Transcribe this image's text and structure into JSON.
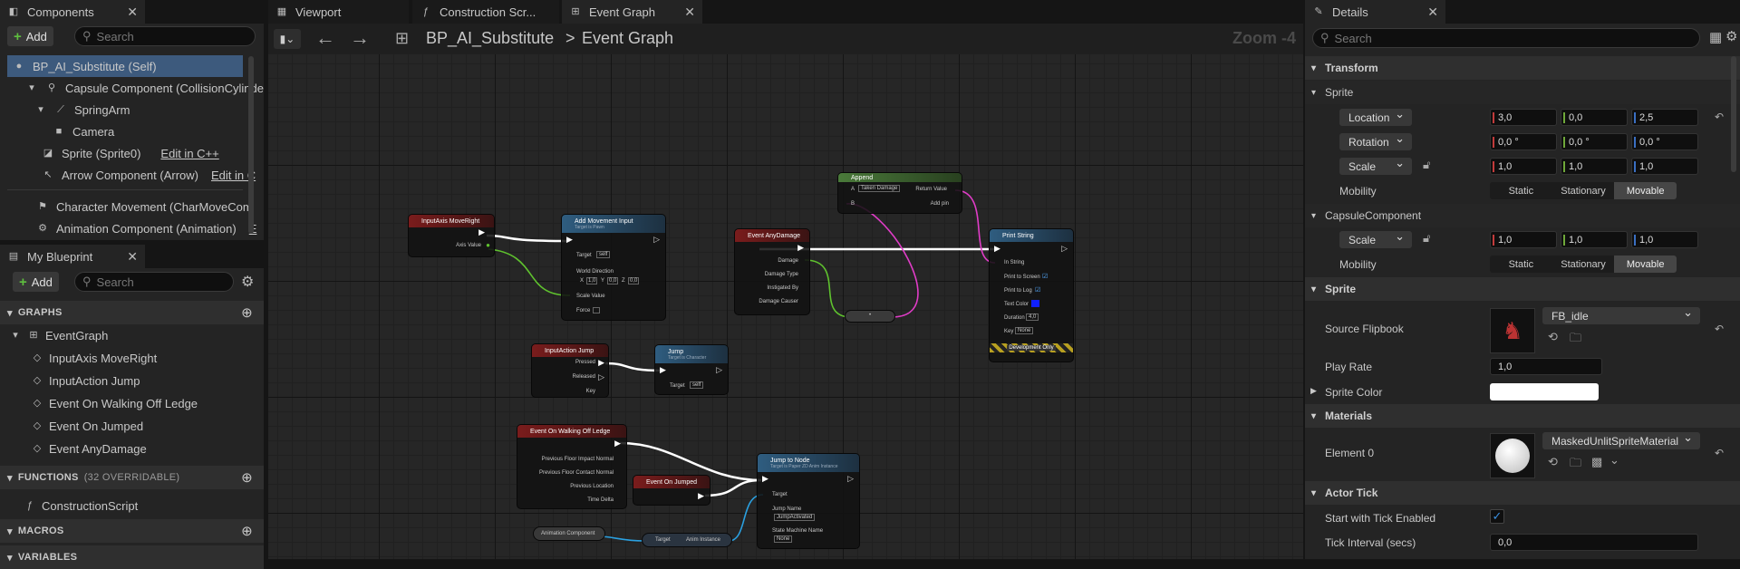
{
  "tabs": {
    "components": "Components",
    "viewport": "Viewport",
    "construction": "Construction Scr...",
    "event_graph": "Event Graph",
    "details": "Details",
    "my_blueprint": "My Blueprint"
  },
  "components_panel": {
    "add_label": "Add",
    "search_placeholder": "Search",
    "items": [
      {
        "label": "BP_AI_Substitute (Self)",
        "extra": ""
      },
      {
        "label": "Capsule Component (CollisionCylinde",
        "extra": ""
      },
      {
        "label": "SpringArm",
        "extra": ""
      },
      {
        "label": "Camera",
        "extra": ""
      },
      {
        "label": "Sprite (Sprite0)",
        "extra": "Edit in C++"
      },
      {
        "label": "Arrow Component (Arrow)",
        "extra": "Edit in C"
      },
      {
        "label": "Character Movement (CharMoveCom",
        "extra": ""
      },
      {
        "label": "Animation Component (Animation)",
        "extra": "E"
      }
    ]
  },
  "my_blueprint": {
    "add_label": "Add",
    "search_placeholder": "Search",
    "graphs_header": "GRAPHS",
    "graphs": [
      "EventGraph",
      "InputAxis MoveRight",
      "InputAction Jump",
      "Event On Walking Off Ledge",
      "Event On Jumped",
      "Event AnyDamage"
    ],
    "functions_header": "FUNCTIONS",
    "functions_count": "(32 OVERRIDABLE)",
    "functions": [
      "ConstructionScript"
    ],
    "macros_header": "MACROS",
    "variables_header": "VARIABLES"
  },
  "graph_toolbar": {
    "breadcrumb_root": "BP_AI_Substitute",
    "breadcrumb_sep": ">",
    "breadcrumb_current": "Event Graph",
    "zoom": "Zoom -4"
  },
  "nodes": {
    "input_axis": {
      "title": "InputAxis MoveRight",
      "pins": [
        "Axis Value"
      ]
    },
    "add_movement": {
      "title": "Add Movement Input",
      "subtitle": "Target is Pawn",
      "pins": [
        "Target",
        "self",
        "World Direction",
        "X",
        "1,0",
        "Y",
        "0,0",
        "Z",
        "0,0",
        "Scale Value",
        "Force"
      ]
    },
    "any_damage": {
      "title": "Event AnyDamage",
      "pins": [
        "Damage",
        "Damage Type",
        "Instigated By",
        "Damage Causer"
      ]
    },
    "append": {
      "title": "Append",
      "pins": [
        "A",
        "Taken Damage",
        "B",
        "Return Value",
        "Add pin"
      ]
    },
    "print_string": {
      "title": "Print String",
      "pins": [
        "In String",
        "Print to Screen",
        "Print to Log",
        "Text Color",
        "Duration",
        "4,0",
        "Key",
        "None",
        "Development Only"
      ]
    },
    "convert": {
      "title": "•"
    },
    "input_jump": {
      "title": "InputAction Jump",
      "pins": [
        "Pressed",
        "Released",
        "Key"
      ]
    },
    "jump": {
      "title": "Jump",
      "subtitle": "Target is Character",
      "pins": [
        "Target",
        "self"
      ]
    },
    "walking_off": {
      "title": "Event On Walking Off Ledge",
      "pins": [
        "Previous Floor Impact Normal",
        "Previous Floor Contact Normal",
        "Previous Location",
        "Time Delta"
      ]
    },
    "on_jumped": {
      "title": "Event On Jumped"
    },
    "jump_to_node": {
      "title": "Jump to Node",
      "subtitle": "Target is Paper ZD Anim Instance",
      "pins": [
        "Target",
        "Jump Name",
        "JumpActivated",
        "State Machine Name",
        "None"
      ]
    },
    "anim_component": {
      "title": "Animation Component"
    },
    "get_anim": {
      "pins": [
        "Target",
        "Anim Instance"
      ]
    }
  },
  "details": {
    "search_placeholder": "Search",
    "transform_header": "Transform",
    "sprite_sub": "Sprite",
    "location_label": "Location",
    "location": [
      "3,0",
      "0,0",
      "2,5"
    ],
    "rotation_label": "Rotation",
    "rotation": [
      "0,0 °",
      "0,0 °",
      "0,0 °"
    ],
    "scale_label": "Scale",
    "scale": [
      "1,0",
      "1,0",
      "1,0"
    ],
    "mobility_label": "Mobility",
    "mobility_options": [
      "Static",
      "Stationary",
      "Movable"
    ],
    "capsule_sub": "CapsuleComponent",
    "capsule_scale_label": "Scale",
    "capsule_scale": [
      "1,0",
      "1,0",
      "1,0"
    ],
    "capsule_mobility_label": "Mobility",
    "sprite_header": "Sprite",
    "source_flipbook_label": "Source Flipbook",
    "source_flipbook_value": "FB_idle",
    "play_rate_label": "Play Rate",
    "play_rate_value": "1,0",
    "sprite_color_label": "Sprite Color",
    "materials_header": "Materials",
    "element0_label": "Element 0",
    "element0_value": "MaskedUnlitSpriteMaterial",
    "actor_tick_header": "Actor Tick",
    "start_tick_label": "Start with Tick Enabled",
    "tick_interval_label": "Tick Interval (secs)",
    "tick_interval_value": "0,0"
  },
  "colors": {
    "accent_green": "#5fbf3f",
    "axis_x": "#c23b3b",
    "axis_y": "#6fa83a",
    "axis_z": "#3a6fc2",
    "exec_wire": "#ffffff",
    "float_wire": "#5fc22e",
    "string_wire": "#e03cc7",
    "object_wire": "#2aa0e0"
  }
}
